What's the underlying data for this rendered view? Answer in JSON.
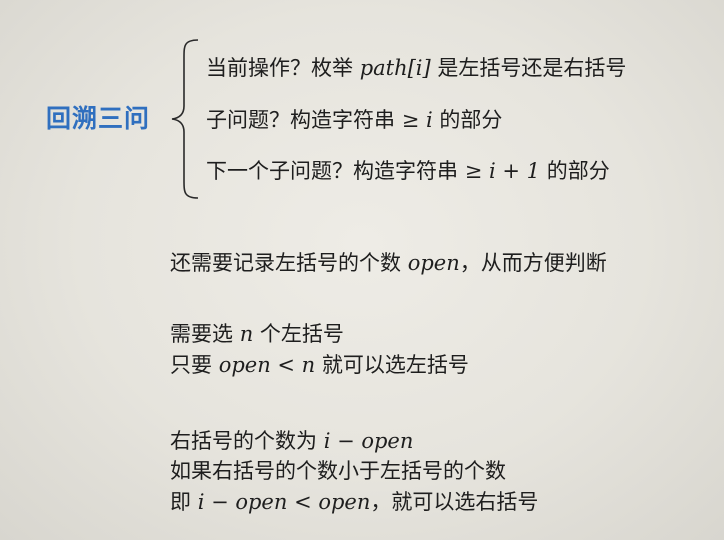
{
  "title": "回溯三问",
  "questions": [
    {
      "pre": "当前操作？枚举 ",
      "math": "path[i]",
      "post": " 是左括号还是右括号"
    },
    {
      "pre": "子问题？构造字符串 ",
      "sym": "≥",
      "math": "i",
      "post": " 的部分"
    },
    {
      "pre": "下一个子问题？构造字符串 ",
      "sym": "≥",
      "math": "i + 1",
      "post": " 的部分"
    }
  ],
  "open_note": {
    "pre": "还需要记录左括号的个数 ",
    "math": "open",
    "post": "，从而方便判断"
  },
  "left_rule": {
    "line1_pre": "需要选 ",
    "line1_math": "n",
    "line1_post": " 个左括号",
    "line2_pre": "只要 ",
    "line2_math": "open < n",
    "line2_post": " 就可以选左括号"
  },
  "right_rule": {
    "line1_pre": "右括号的个数为 ",
    "line1_math": "i − open",
    "line2": "如果右括号的个数小于左括号的个数",
    "line3_pre": "即 ",
    "line3_math": "i − open < open",
    "line3_post": "，就可以选右括号"
  }
}
